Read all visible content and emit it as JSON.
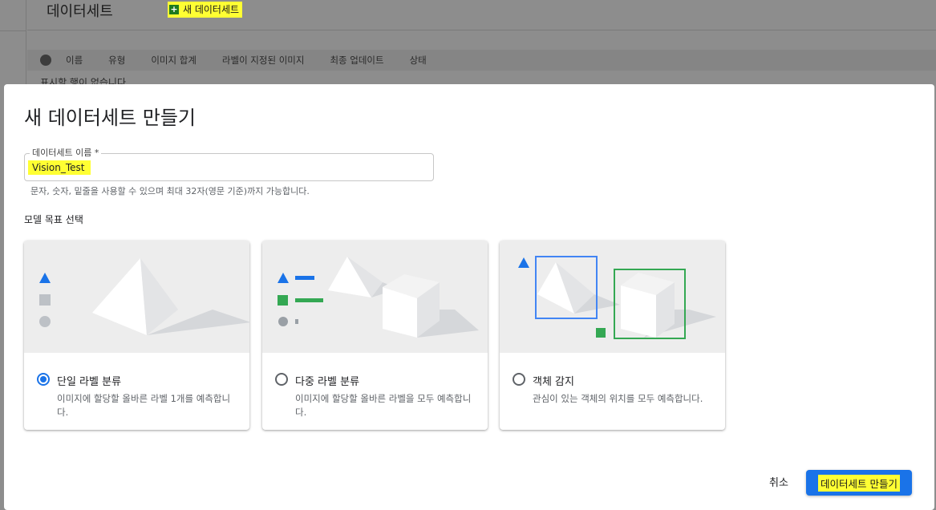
{
  "background": {
    "page_title": "데이터세트",
    "new_dataset_label": "새 데이터세트",
    "columns": [
      "이름",
      "유형",
      "이미지 합계",
      "라벨이 지정된 이미지",
      "최종 업데이트",
      "상태"
    ],
    "empty_text": "표시할 행이 없습니다"
  },
  "dialog": {
    "title": "새 데이터세트 만들기",
    "name_field": {
      "label": "데이터세트 이름 *",
      "value": "Vision_Test",
      "hint": "문자, 숫자, 밑줄을 사용할 수 있으며 최대 32자(영문 기준)까지 가능합니다."
    },
    "objective_label": "모델 목표 선택",
    "options": [
      {
        "title": "단일 라벨 분류",
        "description": "이미지에 할당할 올바른 라벨 1개를 예측합니다.",
        "selected": true
      },
      {
        "title": "다중 라벨 분류",
        "description": "이미지에 할당할 올바른 라벨을 모두 예측합니다.",
        "selected": false
      },
      {
        "title": "객체 감지",
        "description": "관심이 있는 객체의 위치를 모두 예측합니다.",
        "selected": false
      }
    ],
    "cancel_label": "취소",
    "create_label": "데이터세트 만들기"
  },
  "colors": {
    "accent": "#1a73e8",
    "highlight": "#ffff33",
    "green": "#34a853",
    "gray_shape": "#bdc1c6"
  }
}
